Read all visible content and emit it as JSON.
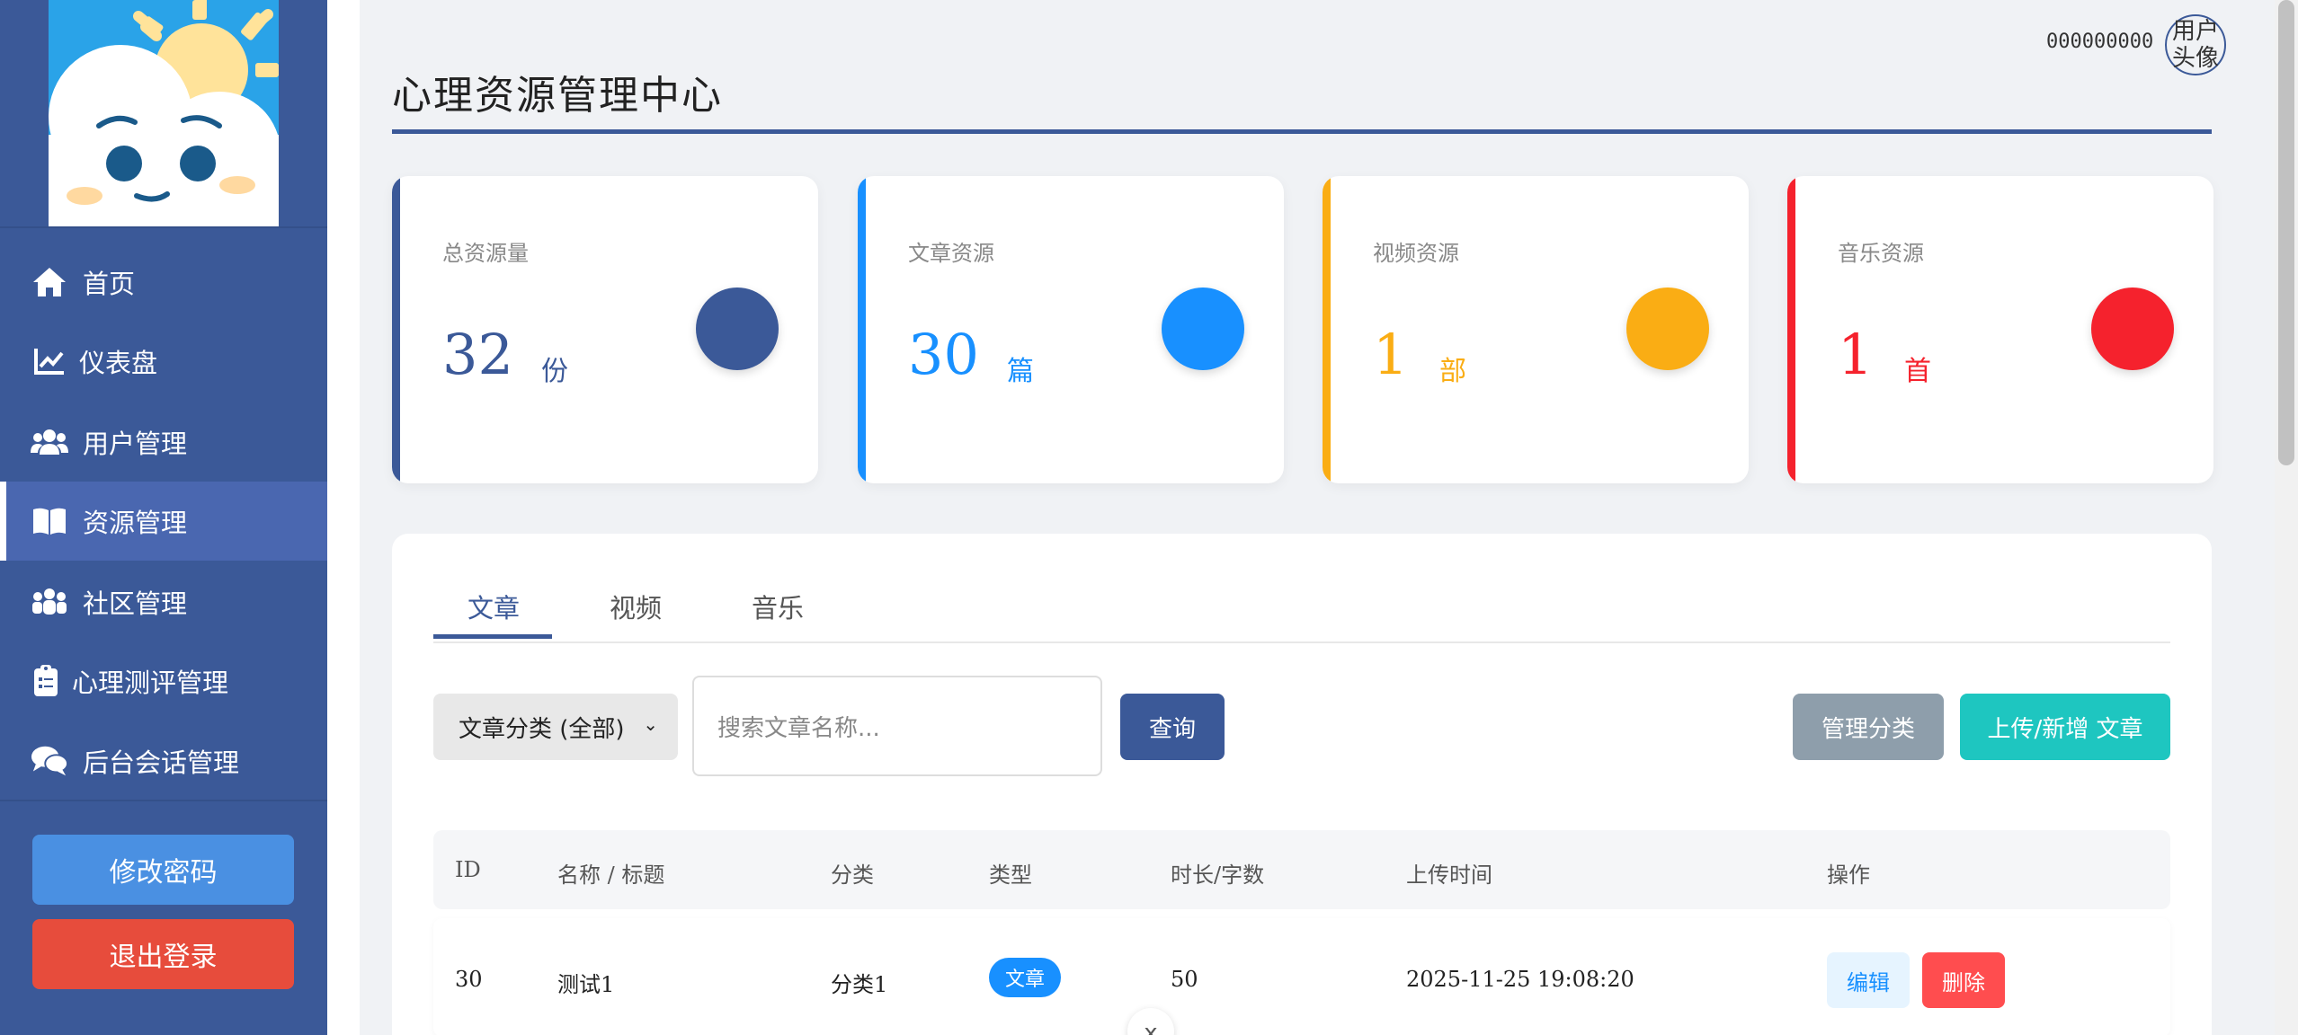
{
  "user": {
    "name": "000000000",
    "avatar_label": "用户头像"
  },
  "sidebar": {
    "items": [
      {
        "label": "首页",
        "icon": "home-icon"
      },
      {
        "label": "仪表盘",
        "icon": "chart-line-icon"
      },
      {
        "label": "用户管理",
        "icon": "users-icon"
      },
      {
        "label": "资源管理",
        "icon": "book-icon",
        "active": true
      },
      {
        "label": "社区管理",
        "icon": "community-icon"
      },
      {
        "label": "心理测评管理",
        "icon": "clipboard-icon"
      },
      {
        "label": "后台会话管理",
        "icon": "chat-icon"
      }
    ],
    "change_password": "修改密码",
    "logout": "退出登录"
  },
  "page": {
    "title": "心理资源管理中心"
  },
  "stats": [
    {
      "label": "总资源量",
      "value": "32",
      "unit": "份",
      "color": "#3b5998"
    },
    {
      "label": "文章资源",
      "value": "30",
      "unit": "篇",
      "color": "#1890ff"
    },
    {
      "label": "视频资源",
      "value": "1",
      "unit": "部",
      "color": "#faad14"
    },
    {
      "label": "音乐资源",
      "value": "1",
      "unit": "首",
      "color": "#f5222d"
    }
  ],
  "tabs": [
    "文章",
    "视频",
    "音乐"
  ],
  "filter": {
    "category_select": "文章分类 (全部)",
    "search_placeholder": "搜索文章名称...",
    "query_button": "查询",
    "manage_category_button": "管理分类",
    "upload_button": "上传/新增 文章"
  },
  "table": {
    "headers": [
      "ID",
      "名称 / 标题",
      "分类",
      "类型",
      "时长/字数",
      "上传时间",
      "操作"
    ],
    "rows": [
      {
        "id": "30",
        "name": "测试1",
        "category": "分类1",
        "type": "文章",
        "length": "50",
        "time": "2025-11-25 19:08:20",
        "edit": "编辑",
        "delete": "删除"
      }
    ]
  },
  "float_close": "x"
}
